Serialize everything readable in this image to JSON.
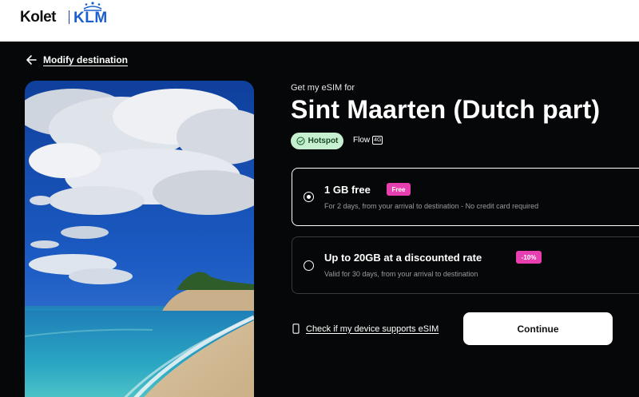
{
  "header": {
    "brand": "Kolet",
    "partner": "KLM",
    "icons": {
      "partner_logo": "klm-crown-icon"
    }
  },
  "nav": {
    "back_label": "Modify destination",
    "back_icon": "arrow-left-icon"
  },
  "destination": {
    "subtitle": "Get my eSIM for",
    "name": "Sint Maarten (Dutch part)",
    "image": "beach-photo"
  },
  "features": {
    "hotspot_label": "Hotspot",
    "hotspot_icon": "check-circle-icon",
    "flow_label": "Flow",
    "network_tag": "4G"
  },
  "plans": [
    {
      "name": "1 GB free",
      "tag": "Free",
      "description": "For 2 days, from your arrival to destination - No credit card required",
      "selected": true
    },
    {
      "name": "Up to 20GB at a discounted rate",
      "tag": "-10%",
      "description": "Valid for 30 days, from your arrival to destination",
      "selected": false
    }
  ],
  "actions": {
    "check_device_label": "Check if my device supports eSIM",
    "check_device_icon": "phone-icon",
    "continue_label": "Continue"
  },
  "colors": {
    "background": "#060708",
    "accent_tag": "#e83fb0",
    "hotspot_badge": "#c6f0cf",
    "klm_blue": "#1a5fcf"
  }
}
